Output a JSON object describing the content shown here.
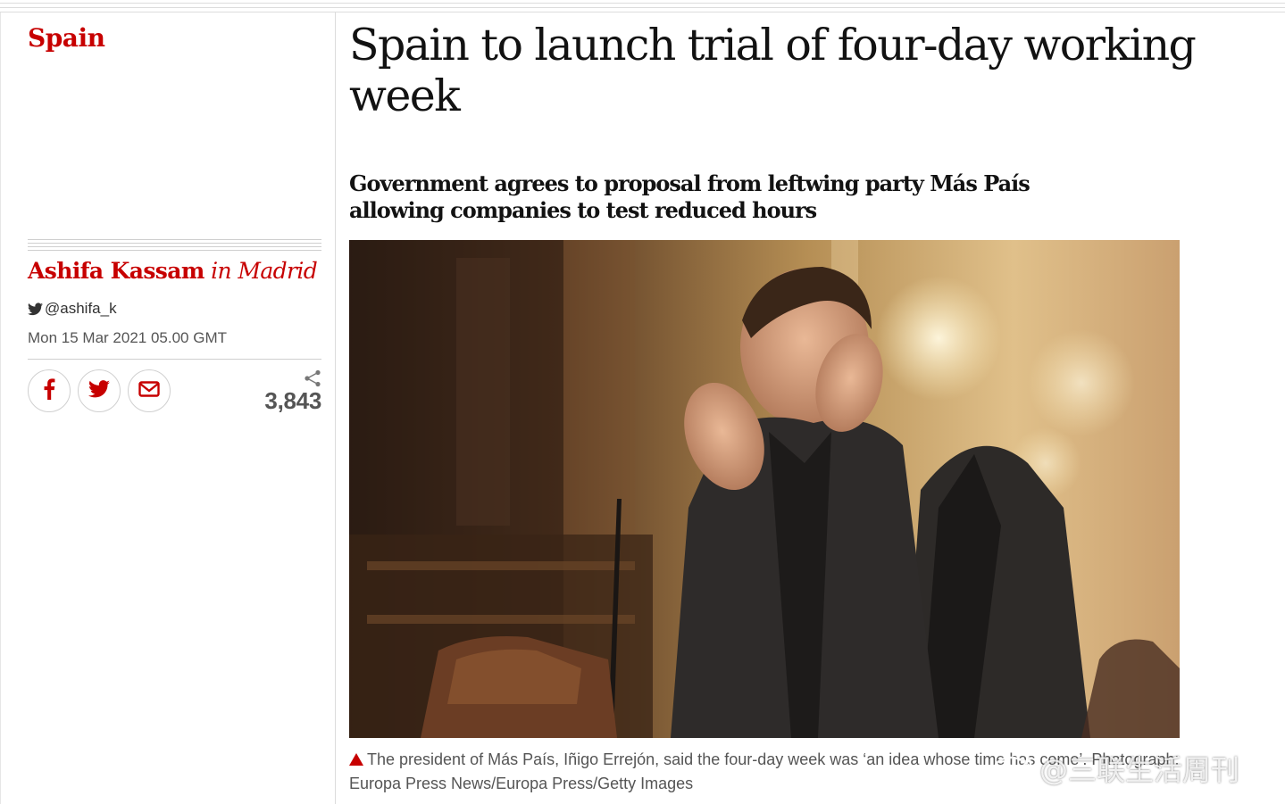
{
  "section": {
    "label": "Spain"
  },
  "byline": {
    "author": "Ashifa Kassam",
    "location": "in Madrid",
    "twitter_handle": "@ashifa_k",
    "date": "Mon 15 Mar 2021 05.00 GMT"
  },
  "share": {
    "buttons": [
      {
        "icon": "facebook-icon"
      },
      {
        "icon": "twitter-icon"
      },
      {
        "icon": "email-icon"
      }
    ],
    "count": "3,843"
  },
  "article": {
    "headline": "Spain to launch trial of four-day working week",
    "standfirst": "Government agrees to proposal from leftwing party Más País allowing companies to test reduced hours"
  },
  "photo": {
    "caption": "The president of Más País, Iñigo Errejón, said the four-day week was ‘an idea whose time has come’. Photograph: Europa Press News/Europa Press/Getty Images"
  },
  "watermark": {
    "text": "@三联生活周刊"
  },
  "colors": {
    "accent": "#c70000",
    "text": "#121212",
    "muted": "#555555",
    "rule": "#dcdcdc"
  }
}
